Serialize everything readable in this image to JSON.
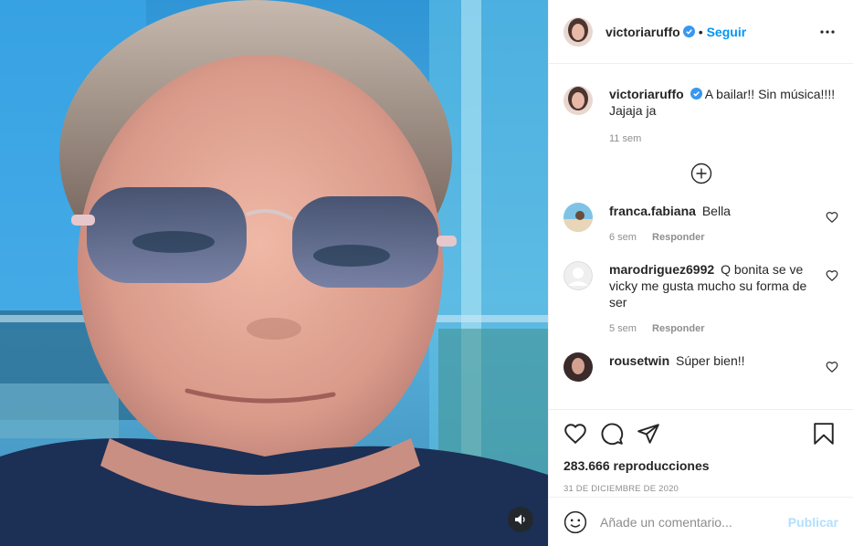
{
  "post": {
    "author": "victoriaruffo",
    "follow_label": "Seguir",
    "separator": "•",
    "caption": "A bailar!! Sin música!!!! Jajaja ja",
    "caption_age": "11 sem",
    "comments": [
      {
        "user": "franca.fabiana",
        "text": "Bella",
        "age": "6 sem",
        "reply_label": "Responder"
      },
      {
        "user": "marodriguez6992",
        "text": "Q bonita se ve vicky me gusta mucho su forma de ser",
        "age": "5 sem",
        "reply_label": "Responder"
      },
      {
        "user": "rousetwin",
        "text": "Súper bien!!"
      }
    ],
    "views": "283.666 reproducciones",
    "date": "31 DE DICIEMBRE DE 2020",
    "comment_placeholder": "Añade un comentario...",
    "post_label": "Publicar"
  },
  "icons": {
    "verified": "verified-badge-icon",
    "more": "more-options-icon",
    "load_more": "plus-circle-icon",
    "like": "heart-icon",
    "comment": "comment-icon",
    "share": "paper-plane-icon",
    "save": "bookmark-icon",
    "emoji": "emoji-icon",
    "sound": "speaker-icon"
  },
  "colors": {
    "link_blue": "#0095f6",
    "disabled_blue": "#b2dffc",
    "verified_blue": "#3897f0",
    "muted": "#8e8e8e"
  }
}
